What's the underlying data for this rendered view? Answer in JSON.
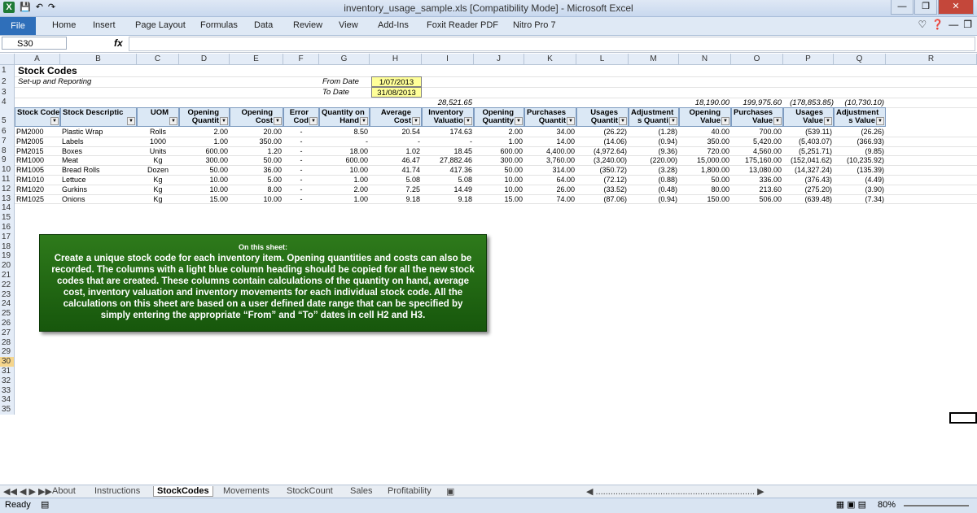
{
  "window": {
    "title": "inventory_usage_sample.xls [Compatibility Mode] - Microsoft Excel"
  },
  "ribbon": {
    "file": "File",
    "tabs": [
      "Home",
      "Insert",
      "Page Layout",
      "Formulas",
      "Data",
      "Review",
      "View",
      "Add-Ins",
      "Foxit Reader PDF",
      "Nitro Pro 7"
    ]
  },
  "formula": {
    "namebox": "S30",
    "fx": "fx",
    "content": ""
  },
  "columns": [
    "A",
    "B",
    "C",
    "D",
    "E",
    "F",
    "G",
    "H",
    "I",
    "J",
    "K",
    "L",
    "M",
    "N",
    "O",
    "P",
    "Q",
    "R"
  ],
  "rows": [
    "1",
    "2",
    "3",
    "4",
    "5",
    "6",
    "7",
    "8",
    "9",
    "10",
    "11",
    "12",
    "13",
    "14",
    "15",
    "16",
    "17",
    "18",
    "19",
    "20",
    "21",
    "22",
    "23",
    "24",
    "25",
    "26",
    "27",
    "28",
    "29",
    "30",
    "31",
    "32",
    "33",
    "34",
    "35"
  ],
  "sheet": {
    "title": "Stock Codes",
    "subtitle": "Set-up and Reporting",
    "from_label": "From Date",
    "to_label": "To Date",
    "from_date": "1/07/2013",
    "to_date": "31/08/2013",
    "totals": {
      "I": "28,521.65",
      "N": "18,190.00",
      "O": "199,975.60",
      "P": "(178,853.85)",
      "Q": "(10,730.10)"
    },
    "headers": [
      {
        "top": "",
        "bottom": "Stock Code"
      },
      {
        "top": "",
        "bottom": "Stock Descriptic"
      },
      {
        "top": "",
        "bottom": "UOM"
      },
      {
        "top": "Opening",
        "bottom": "Quantit"
      },
      {
        "top": "Opening",
        "bottom": "Cost"
      },
      {
        "top": "Error",
        "bottom": "Cod"
      },
      {
        "top": "Quantity on",
        "bottom": "Hand"
      },
      {
        "top": "Average",
        "bottom": "Cost"
      },
      {
        "top": "Inventory",
        "bottom": "Valuatio"
      },
      {
        "top": "Opening",
        "bottom": "Quantity"
      },
      {
        "top": "Purchases",
        "bottom": "Quantit"
      },
      {
        "top": "Usages",
        "bottom": "Quantit"
      },
      {
        "top": "Adjustment",
        "bottom": "s Quanti"
      },
      {
        "top": "Opening",
        "bottom": "Value"
      },
      {
        "top": "Purchases",
        "bottom": "Value"
      },
      {
        "top": "Usages",
        "bottom": "Value"
      },
      {
        "top": "Adjustment",
        "bottom": "s Value"
      }
    ],
    "data": [
      [
        "PM2000",
        "Plastic Wrap",
        "Rolls",
        "2.00",
        "20.00",
        "-",
        "8.50",
        "20.54",
        "174.63",
        "2.00",
        "34.00",
        "(26.22)",
        "(1.28)",
        "40.00",
        "700.00",
        "(539.11)",
        "(26.26)"
      ],
      [
        "PM2005",
        "Labels",
        "1000",
        "1.00",
        "350.00",
        "-",
        "-",
        "-",
        "-",
        "1.00",
        "14.00",
        "(14.06)",
        "(0.94)",
        "350.00",
        "5,420.00",
        "(5,403.07)",
        "(366.93)"
      ],
      [
        "PM2015",
        "Boxes",
        "Units",
        "600.00",
        "1.20",
        "-",
        "18.00",
        "1.02",
        "18.45",
        "600.00",
        "4,400.00",
        "(4,972.64)",
        "(9.36)",
        "720.00",
        "4,560.00",
        "(5,251.71)",
        "(9.85)"
      ],
      [
        "RM1000",
        "Meat",
        "Kg",
        "300.00",
        "50.00",
        "-",
        "600.00",
        "46.47",
        "27,882.46",
        "300.00",
        "3,760.00",
        "(3,240.00)",
        "(220.00)",
        "15,000.00",
        "175,160.00",
        "(152,041.62)",
        "(10,235.92)"
      ],
      [
        "RM1005",
        "Bread Rolls",
        "Dozen",
        "50.00",
        "36.00",
        "-",
        "10.00",
        "41.74",
        "417.36",
        "50.00",
        "314.00",
        "(350.72)",
        "(3.28)",
        "1,800.00",
        "13,080.00",
        "(14,327.24)",
        "(135.39)"
      ],
      [
        "RM1010",
        "Lettuce",
        "Kg",
        "10.00",
        "5.00",
        "-",
        "1.00",
        "5.08",
        "5.08",
        "10.00",
        "64.00",
        "(72.12)",
        "(0.88)",
        "50.00",
        "336.00",
        "(376.43)",
        "(4.49)"
      ],
      [
        "RM1020",
        "Gurkins",
        "Kg",
        "10.00",
        "8.00",
        "-",
        "2.00",
        "7.25",
        "14.49",
        "10.00",
        "26.00",
        "(33.52)",
        "(0.48)",
        "80.00",
        "213.60",
        "(275.20)",
        "(3.90)"
      ],
      [
        "RM1025",
        "Onions",
        "Kg",
        "15.00",
        "10.00",
        "-",
        "1.00",
        "9.18",
        "9.18",
        "15.00",
        "74.00",
        "(87.06)",
        "(0.94)",
        "150.00",
        "506.00",
        "(639.48)",
        "(7.34)"
      ]
    ]
  },
  "note": {
    "title": "On this sheet:",
    "body": "Create a unique stock code for each inventory item. Opening quantities and costs can also be recorded. The columns with a light blue column heading should be copied for all the new stock codes that are created. These columns contain calculations of the quantity on hand, average cost, inventory valuation and inventory movements for each individual stock code. All the calculations on this sheet are based on a user defined date range that can be specified by simply entering the appropriate “From” and “To” dates in cell H2 and H3."
  },
  "sheet_tabs": [
    "About",
    "Instructions",
    "StockCodes",
    "Movements",
    "StockCount",
    "Sales",
    "Profitability"
  ],
  "active_tab": "StockCodes",
  "status": {
    "ready": "Ready",
    "zoom": "80%"
  }
}
